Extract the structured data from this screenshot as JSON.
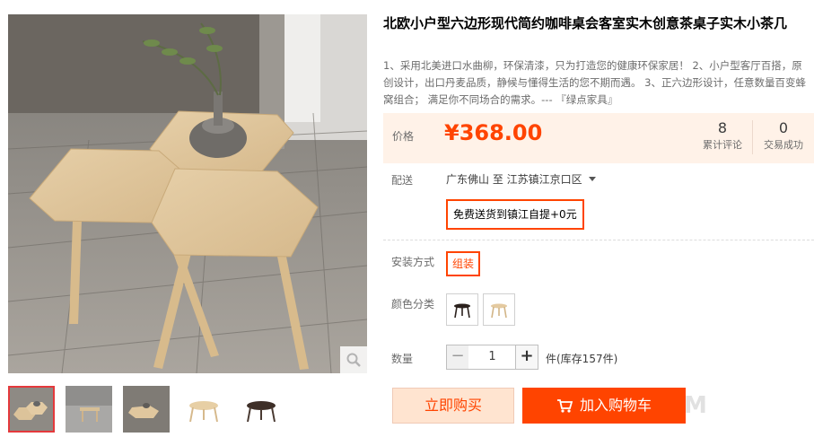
{
  "product": {
    "title": "北欧小户型六边形现代简约咖啡桌会客室实木创意茶桌子实木小茶几",
    "subtitle": "1、采用北美进口水曲柳，环保清漆，只为打造您的健康环保家居！ 2、小户型客厅百搭，原创设计，出口丹麦品质，静候与懂得生活的您不期而遇。 3、正六边形设计，任意数量百变蜂窝组合； 满足你不同场合的需求。--- 『绿点家具』"
  },
  "price": {
    "label": "价格",
    "value": "¥368.00",
    "reviews_count": "8",
    "reviews_label": "累计评论",
    "deals_count": "0",
    "deals_label": "交易成功"
  },
  "delivery": {
    "label": "配送",
    "route": "广东佛山 至  江苏镇江京口区",
    "option": "免费送货到镇江自提+0元"
  },
  "install": {
    "label": "安装方式",
    "option": "组装"
  },
  "color": {
    "label": "颜色分类",
    "options": [
      "black-legs-table",
      "natural-wood-table"
    ]
  },
  "quantity": {
    "label": "数量",
    "value": "1",
    "minus": "−",
    "plus": "+",
    "stock": "件(库存157件)"
  },
  "actions": {
    "buy_now": "立即购买",
    "add_to_cart": "加入购物车"
  },
  "watermark": "M",
  "colors": {
    "accent": "#ff4400",
    "price_bg": "#fff2e8",
    "buy_now_bg": "#ffe4d0"
  }
}
